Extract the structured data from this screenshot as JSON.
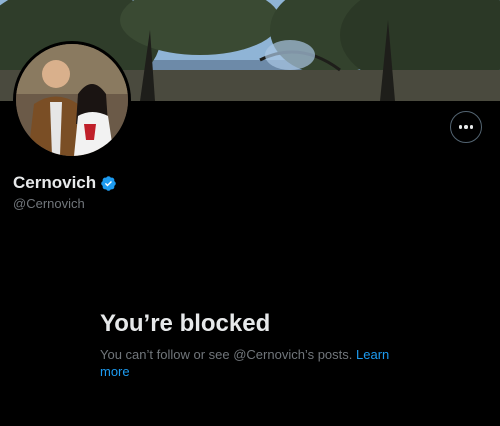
{
  "profile": {
    "display_name": "Cernovich",
    "handle": "@Cernovich",
    "verified_icon": "verified-badge-icon"
  },
  "actions": {
    "more_icon": "more-horizontal-icon"
  },
  "blocked": {
    "title": "You’re blocked",
    "message": "You can’t follow or see @Cernovich’s posts.",
    "learn_more": "Learn more"
  },
  "colors": {
    "background": "#000000",
    "primary_text": "#e7e9ea",
    "secondary_text": "#71767b",
    "accent": "#1d9bf0"
  }
}
